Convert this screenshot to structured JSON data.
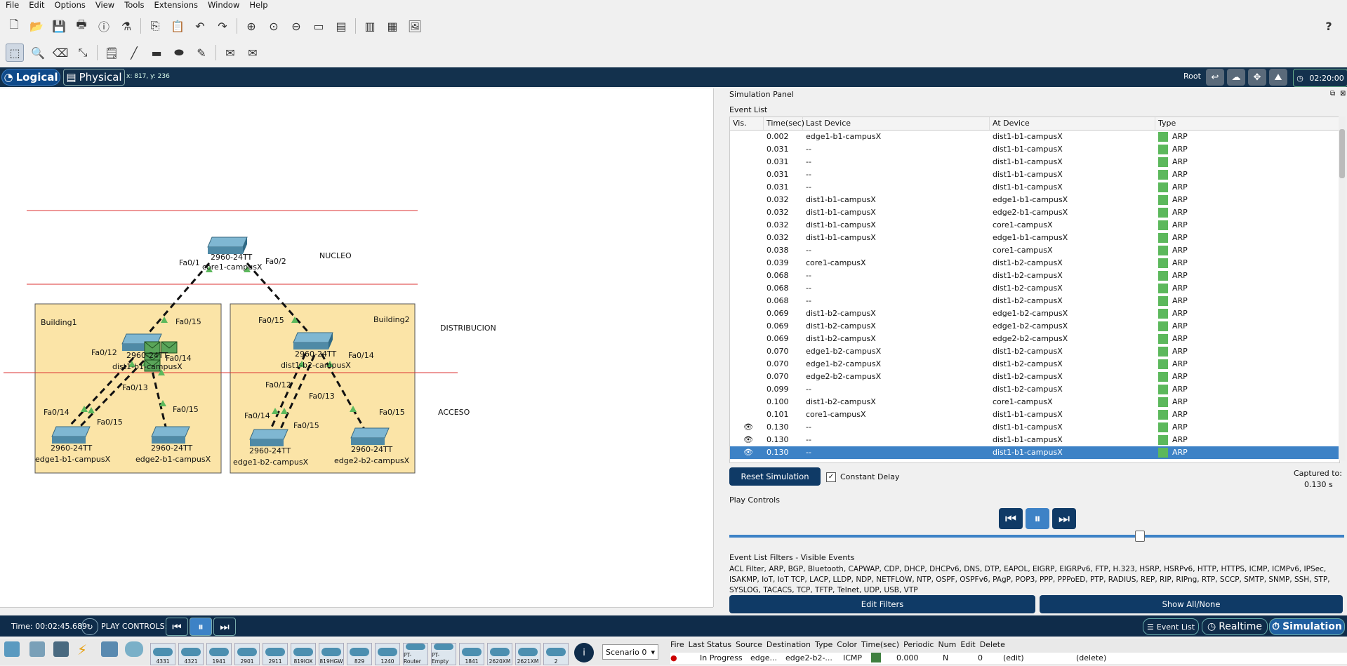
{
  "menu": [
    "File",
    "Edit",
    "Options",
    "View",
    "Tools",
    "Extensions",
    "Window",
    "Help"
  ],
  "toolbar_main": [
    "new-file-icon",
    "open-folder-icon",
    "save-icon",
    "print-icon",
    "info-icon",
    "network-wizard-icon",
    "copy-icon",
    "paste-icon",
    "undo-icon",
    "redo-icon",
    "zoom-in-icon",
    "zoom-reset-icon",
    "zoom-out-icon",
    "drawing-palette-icon",
    "custom-device-icon",
    "viewport-icon",
    "cluster-icon",
    "image-icon"
  ],
  "toolbar_tools": [
    "select-icon",
    "inspect-icon",
    "delete-icon",
    "resize-icon",
    "note-icon",
    "line-icon",
    "rectangle-icon",
    "ellipse-icon",
    "freeform-icon",
    "simple-pdu-icon",
    "complex-pdu-icon"
  ],
  "help_icon": "?",
  "tabs": {
    "logical": "Logical",
    "physical": "Physical"
  },
  "coords": "x: 817, y: 236",
  "root_label": "Root",
  "clock": "02:20:00",
  "canvas": {
    "labels": {
      "nucleo": "NUCLEO",
      "distribucion": "DISTRIBUCION",
      "acceso": "ACCESO",
      "building1": "Building1",
      "building2": "Building2"
    },
    "devices": {
      "core1": {
        "model": "2960-24TT",
        "name": "core1-campusX"
      },
      "dist1_b1": {
        "model": "2960-24TT",
        "name": "dist1-b1-campusX"
      },
      "dist1_b2": {
        "model": "2960-24TT",
        "name": "dist1-b2-campusX"
      },
      "edge1_b1": {
        "model": "2960-24TT",
        "name": "edge1-b1-campusX"
      },
      "edge2_b1": {
        "model": "2960-24TT",
        "name": "edge2-b1-campusX"
      },
      "edge1_b2": {
        "model": "2960-24TT",
        "name": "edge1-b2-campusX"
      },
      "edge2_b2": {
        "model": "2960-24TT",
        "name": "edge2-b2-campusX"
      }
    },
    "ports": {
      "core_fa01": "Fa0/1",
      "core_fa02": "Fa0/2",
      "b1_fa015": "Fa0/15",
      "b1_fa012": "Fa0/12",
      "b1_fa014": "Fa0/14",
      "b1_fa013": "Fa0/13",
      "b1_e1_fa014": "Fa0/14",
      "b1_e1_fa015": "Fa0/15",
      "b1_e2_fa015": "Fa0/15",
      "b2_fa015": "Fa0/15",
      "b2_fa014": "Fa0/14",
      "b2_fa012": "Fa0/12",
      "b2_fa013": "Fa0/13",
      "b2_e1_fa014": "Fa0/14",
      "b2_e1_fa015": "Fa0/15",
      "b2_e2_fa015": "Fa0/15"
    }
  },
  "sim": {
    "title": "Simulation Panel",
    "event_list_label": "Event List",
    "columns": [
      "Vis.",
      "Time(sec)",
      "Last Device",
      "At Device",
      "Type"
    ],
    "events": [
      {
        "vis": "",
        "time": "0.002",
        "last": "edge1-b1-campusX",
        "at": "dist1-b1-campusX",
        "type": "ARP"
      },
      {
        "vis": "",
        "time": "0.031",
        "last": "--",
        "at": "dist1-b1-campusX",
        "type": "ARP"
      },
      {
        "vis": "",
        "time": "0.031",
        "last": "--",
        "at": "dist1-b1-campusX",
        "type": "ARP"
      },
      {
        "vis": "",
        "time": "0.031",
        "last": "--",
        "at": "dist1-b1-campusX",
        "type": "ARP"
      },
      {
        "vis": "",
        "time": "0.031",
        "last": "--",
        "at": "dist1-b1-campusX",
        "type": "ARP"
      },
      {
        "vis": "",
        "time": "0.032",
        "last": "dist1-b1-campusX",
        "at": "edge1-b1-campusX",
        "type": "ARP"
      },
      {
        "vis": "",
        "time": "0.032",
        "last": "dist1-b1-campusX",
        "at": "edge2-b1-campusX",
        "type": "ARP"
      },
      {
        "vis": "",
        "time": "0.032",
        "last": "dist1-b1-campusX",
        "at": "core1-campusX",
        "type": "ARP"
      },
      {
        "vis": "",
        "time": "0.032",
        "last": "dist1-b1-campusX",
        "at": "edge1-b1-campusX",
        "type": "ARP"
      },
      {
        "vis": "",
        "time": "0.038",
        "last": "--",
        "at": "core1-campusX",
        "type": "ARP"
      },
      {
        "vis": "",
        "time": "0.039",
        "last": "core1-campusX",
        "at": "dist1-b2-campusX",
        "type": "ARP"
      },
      {
        "vis": "",
        "time": "0.068",
        "last": "--",
        "at": "dist1-b2-campusX",
        "type": "ARP"
      },
      {
        "vis": "",
        "time": "0.068",
        "last": "--",
        "at": "dist1-b2-campusX",
        "type": "ARP"
      },
      {
        "vis": "",
        "time": "0.068",
        "last": "--",
        "at": "dist1-b2-campusX",
        "type": "ARP"
      },
      {
        "vis": "",
        "time": "0.069",
        "last": "dist1-b2-campusX",
        "at": "edge1-b2-campusX",
        "type": "ARP"
      },
      {
        "vis": "",
        "time": "0.069",
        "last": "dist1-b2-campusX",
        "at": "edge1-b2-campusX",
        "type": "ARP"
      },
      {
        "vis": "",
        "time": "0.069",
        "last": "dist1-b2-campusX",
        "at": "edge2-b2-campusX",
        "type": "ARP"
      },
      {
        "vis": "",
        "time": "0.070",
        "last": "edge1-b2-campusX",
        "at": "dist1-b2-campusX",
        "type": "ARP"
      },
      {
        "vis": "",
        "time": "0.070",
        "last": "edge1-b2-campusX",
        "at": "dist1-b2-campusX",
        "type": "ARP"
      },
      {
        "vis": "",
        "time": "0.070",
        "last": "edge2-b2-campusX",
        "at": "dist1-b2-campusX",
        "type": "ARP"
      },
      {
        "vis": "",
        "time": "0.099",
        "last": "--",
        "at": "dist1-b2-campusX",
        "type": "ARP"
      },
      {
        "vis": "",
        "time": "0.100",
        "last": "dist1-b2-campusX",
        "at": "core1-campusX",
        "type": "ARP"
      },
      {
        "vis": "",
        "time": "0.101",
        "last": "core1-campusX",
        "at": "dist1-b1-campusX",
        "type": "ARP"
      },
      {
        "vis": "eye",
        "time": "0.130",
        "last": "--",
        "at": "dist1-b1-campusX",
        "type": "ARP"
      },
      {
        "vis": "eye",
        "time": "0.130",
        "last": "--",
        "at": "dist1-b1-campusX",
        "type": "ARP"
      },
      {
        "vis": "eye",
        "time": "0.130",
        "last": "--",
        "at": "dist1-b1-campusX",
        "type": "ARP",
        "selected": true
      }
    ],
    "arp_color": "#5cb85c",
    "reset_label": "Reset Simulation",
    "constant_delay_label": "Constant Delay",
    "constant_delay_checked": "✓",
    "captured_label": "Captured to:",
    "captured_value": "0.130 s",
    "play_controls_label": "Play Controls",
    "play_speed_fraction": 0.5,
    "filters_label": "Event List Filters - Visible Events",
    "filters_text": "ACL Filter, ARP, BGP, Bluetooth, CAPWAP, CDP, DHCP, DHCPv6, DNS, DTP, EAPOL, EIGRP, EIGRPv6, FTP, H.323, HSRP, HSRPv6, HTTP, HTTPS, ICMP, ICMPv6, IPSec, ISAKMP, IoT, IoT TCP, LACP, LLDP, NDP, NETFLOW, NTP, OSPF, OSPFv6, PAgP, POP3, PPP, PPPoED, PTP, RADIUS, REP, RIP, RIPng, RTP, SCCP, SMTP, SNMP, SSH, STP, SYSLOG, TACACS, TCP, TFTP, Telnet, UDP, USB, VTP",
    "edit_filters_label": "Edit Filters",
    "show_all_label": "Show All/None"
  },
  "bottom": {
    "time": "Time: 00:02:45.689",
    "play_controls": "PLAY CONTROLS:",
    "event_list": "Event List",
    "realtime": "Realtime",
    "simulation": "Simulation"
  },
  "devices_strip": [
    "4331",
    "4321",
    "1941",
    "2901",
    "2911",
    "819IOX",
    "819HGW",
    "829",
    "1240",
    "PT-Router",
    "PT-Empty",
    "1841",
    "2620XM",
    "2621XM",
    "2"
  ],
  "scenario": "Scenario 0",
  "pdu": {
    "columns": [
      "Fire",
      "Last Status",
      "Source",
      "Destination",
      "Type",
      "Color",
      "Time(sec)",
      "Periodic",
      "Num",
      "Edit",
      "Delete"
    ],
    "row": {
      "fire": "",
      "status": "In Progress",
      "source": "edge...",
      "destination": "edge2-b2-...",
      "type": "ICMP",
      "color": "#3f7f3f",
      "time": "0.000",
      "periodic": "N",
      "num": "0",
      "edit": "(edit)",
      "delete": "(delete)"
    }
  }
}
